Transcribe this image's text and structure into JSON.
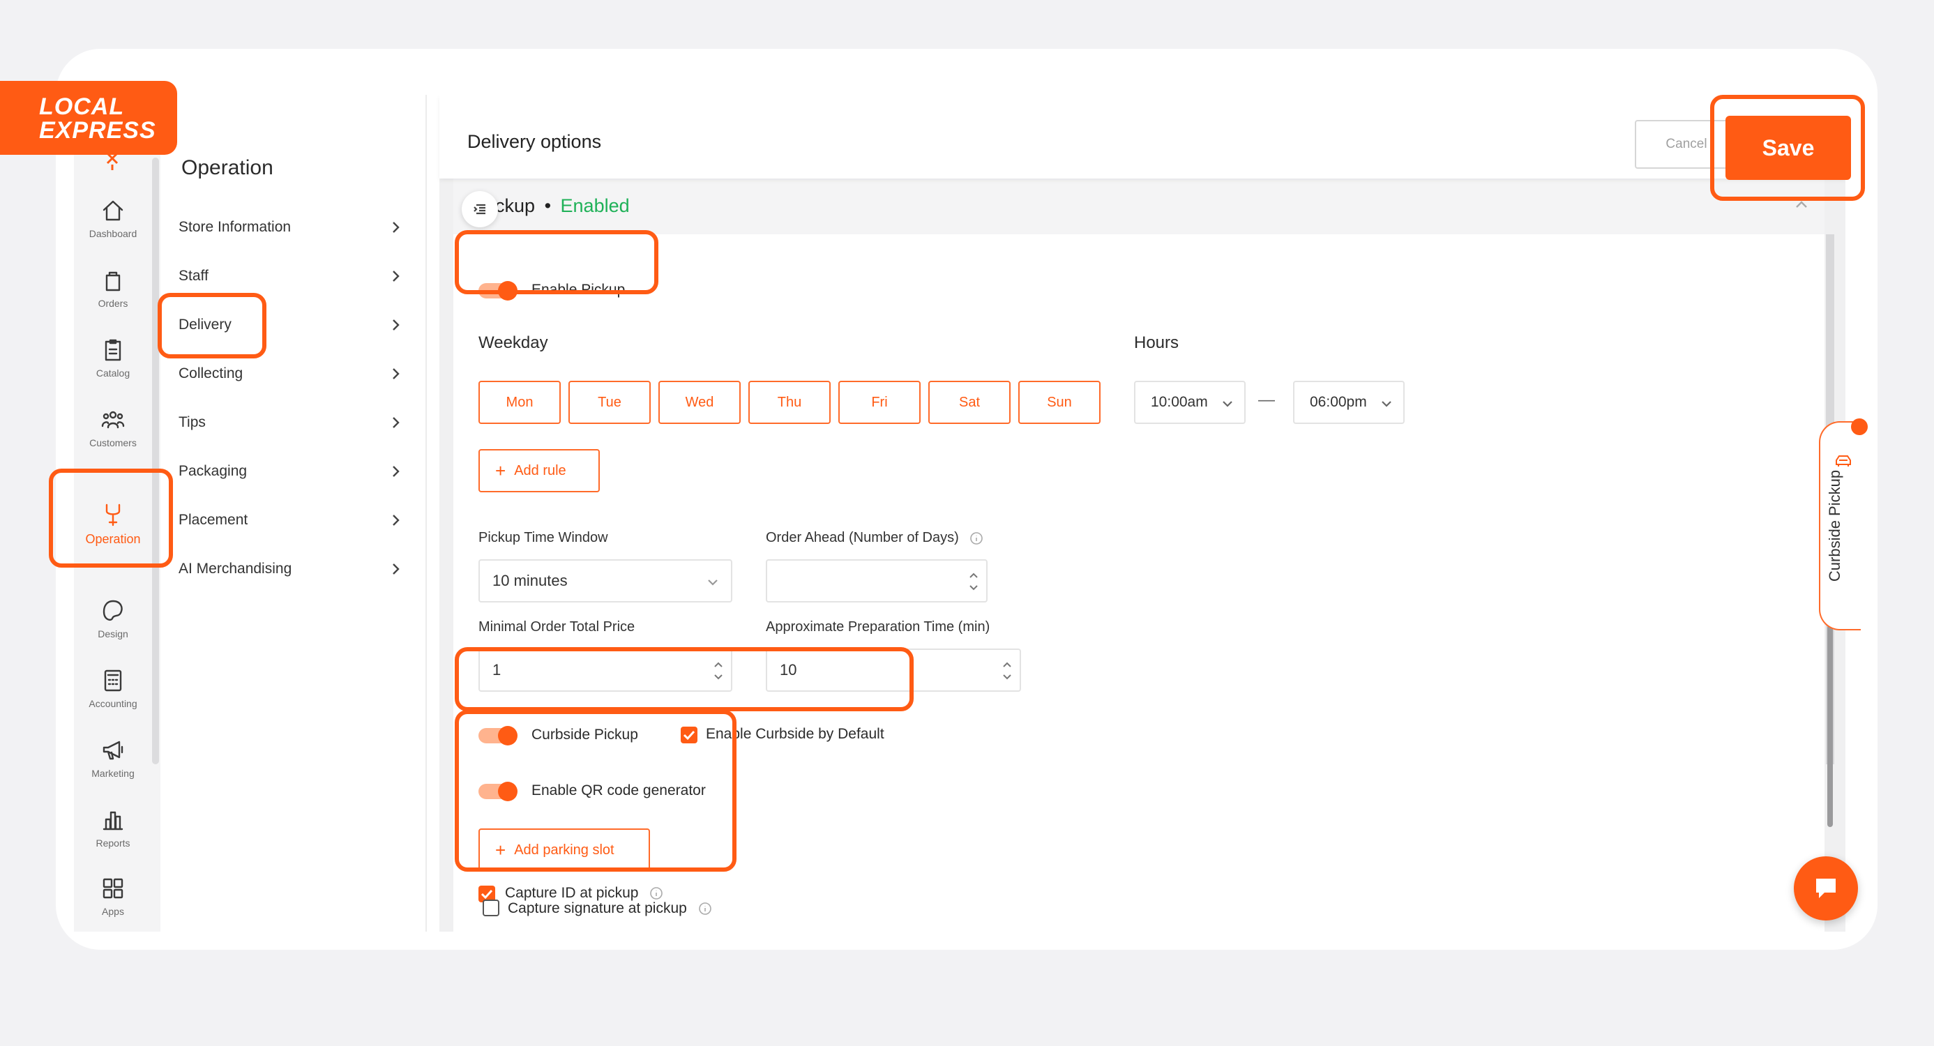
{
  "brand": {
    "logo_line1": "LOCAL",
    "logo_line2": "EXPRESS",
    "accent_color": "#ff5b14",
    "enabled_color": "#1fb158"
  },
  "rail": {
    "items": [
      {
        "label": "Dashboard",
        "icon": "home-icon"
      },
      {
        "label": "Orders",
        "icon": "bag-icon"
      },
      {
        "label": "Catalog",
        "icon": "clipboard-icon"
      },
      {
        "label": "Customers",
        "icon": "people-icon"
      },
      {
        "label": "Operation",
        "icon": "wrench-icon"
      },
      {
        "label": "Design",
        "icon": "palette-icon"
      },
      {
        "label": "Accounting",
        "icon": "calculator-icon"
      },
      {
        "label": "Marketing",
        "icon": "megaphone-icon"
      },
      {
        "label": "Reports",
        "icon": "bar-chart-icon"
      },
      {
        "label": "Apps",
        "icon": "apps-grid-icon"
      }
    ]
  },
  "submenu": {
    "title": "Operation",
    "items": [
      {
        "label": "Store Information"
      },
      {
        "label": "Staff"
      },
      {
        "label": "Delivery"
      },
      {
        "label": "Collecting"
      },
      {
        "label": "Tips"
      },
      {
        "label": "Packaging"
      },
      {
        "label": "Placement"
      },
      {
        "label": "AI Merchandising"
      }
    ]
  },
  "header": {
    "title": "Delivery options",
    "cancel_label": "Cancel",
    "save_label": "Save"
  },
  "pickup": {
    "title": "Pickup",
    "separator": "•",
    "status": "Enabled",
    "enable_label": "Enable Pickup",
    "weekday_label": "Weekday",
    "hours_label": "Hours",
    "days": [
      "Mon",
      "Tue",
      "Wed",
      "Thu",
      "Fri",
      "Sat",
      "Sun"
    ],
    "hours_from": "10:00am",
    "hours_to": "06:00pm",
    "hours_dash": "—",
    "add_rule_label": "Add rule",
    "time_window_label": "Pickup Time Window",
    "time_window_value": "10 minutes",
    "order_ahead_label": "Order Ahead (Number of Days)",
    "order_ahead_value": "",
    "min_order_label": "Minimal Order Total Price",
    "min_order_value": "1",
    "prep_time_label": "Approximate Preparation Time (min)",
    "prep_time_value": "10",
    "curbside_label": "Curbside Pickup",
    "curbside_default_label": "Enable Curbside by Default",
    "qr_label": "Enable QR code generator",
    "add_parking_label": "Add parking slot",
    "capture_id_label": "Capture ID at pickup",
    "capture_signature_label": "Capture signature at pickup"
  },
  "side_tab": {
    "label": "Curbside Pickup"
  }
}
